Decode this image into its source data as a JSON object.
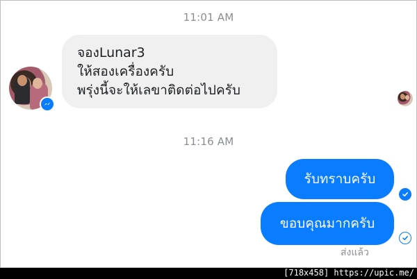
{
  "conversation": {
    "timestamp_1": "11:01 AM",
    "incoming_message": {
      "lines": [
        "จองLunar3",
        "ให้สองเครื่องครับ",
        "พรุ่งนี้จะให้เลขาติดต่อไปครับ"
      ]
    },
    "timestamp_2": "11:16 AM",
    "outgoing_messages": [
      "รับทราบครับ",
      "ขอบคุณมากครับ"
    ],
    "seen_status": "ส่งแล้ว"
  },
  "watermark": "[718x458] https://upic.me/",
  "colors": {
    "accent": "#0a7cff",
    "incoming_bubble": "#f0f0f0",
    "timestamp_text": "#8a8d91"
  },
  "icons": {
    "avatar": "contact-avatar",
    "badge": "messenger-icon",
    "delivered": "checkmark-icon"
  }
}
